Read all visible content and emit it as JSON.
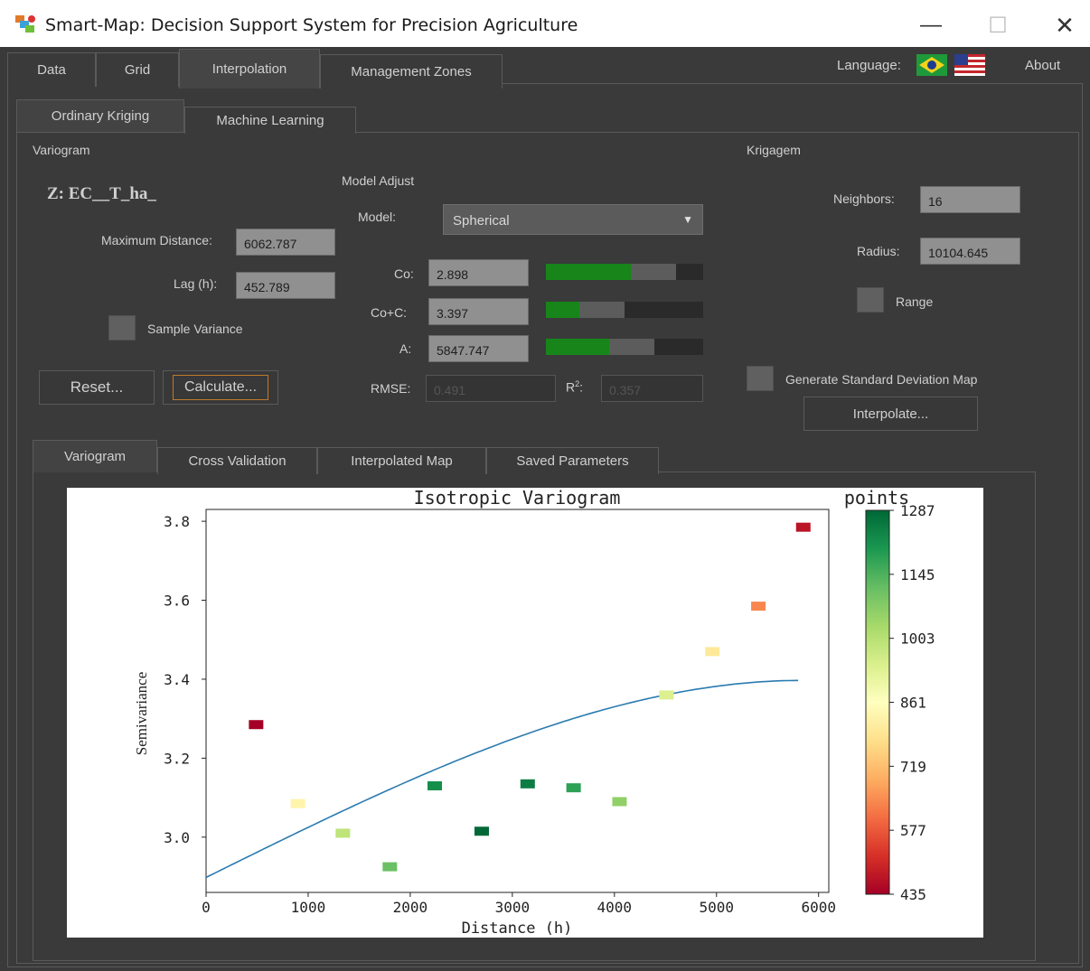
{
  "window": {
    "title": "Smart-Map: Decision Support System for Precision Agriculture",
    "minimize_glyph": "—",
    "maximize_glyph": "☐",
    "close_glyph": "✕"
  },
  "top_tabs": [
    "Data",
    "Grid",
    "Interpolation",
    "Management Zones"
  ],
  "language_label": "Language:",
  "about_label": "About",
  "sub_tabs": [
    "Ordinary Kriging",
    "Machine Learning"
  ],
  "variogram_section": {
    "heading": "Variogram",
    "z_label": "Z: EC__T_ha_",
    "max_distance_label": "Maximum Distance:",
    "max_distance_value": "6062.787",
    "lag_label": "Lag (h):",
    "lag_value": "452.789",
    "sample_variance_label": "Sample Variance",
    "reset_label": "Reset...",
    "calculate_label": "Calculate..."
  },
  "model_adjust": {
    "heading": "Model Adjust",
    "model_label": "Model:",
    "model_value": "Spherical",
    "co_label": "Co:",
    "co_value": "2.898",
    "coc_label": "Co+C:",
    "coc_value": "3.397",
    "a_label": "A:",
    "a_value": "5847.747",
    "rmse_label": "RMSE:",
    "rmse_value": "0.491",
    "r2_label": "R",
    "r2_sup": "2",
    "r2_colon": ":",
    "r2_value": "0.357",
    "sliders": [
      {
        "fill": 0.54,
        "mid": 0.83
      },
      {
        "fill": 0.21,
        "mid": 0.5
      },
      {
        "fill": 0.4,
        "mid": 0.69
      }
    ]
  },
  "krigagem": {
    "heading": "Krigagem",
    "neighbors_label": "Neighbors:",
    "neighbors_value": "16",
    "radius_label": "Radius:",
    "radius_value": "10104.645",
    "range_label": "Range",
    "std_map_label": "Generate Standard Deviation Map",
    "interpolate_label": "Interpolate..."
  },
  "bottom_tabs": [
    "Variogram",
    "Cross Validation",
    "Interpolated Map",
    "Saved Parameters"
  ],
  "colors": {
    "bg": "#3a3a3a",
    "accent_green": "#17851a",
    "field_bg": "#909090",
    "line_blue": "#2b7bb0"
  },
  "chart_data": {
    "type": "scatter",
    "title": "Isotropic Variogram",
    "xlabel": "Distance (h)",
    "ylabel": "Semivariance",
    "xlim": [
      0,
      6100
    ],
    "ylim": [
      2.86,
      3.83
    ],
    "x_ticks": [
      0,
      1000,
      2000,
      3000,
      4000,
      5000,
      6000
    ],
    "y_ticks": [
      3.0,
      3.2,
      3.4,
      3.6,
      3.8
    ],
    "y_tick_labels": [
      "3.0",
      "3.2",
      "3.4",
      "3.6",
      "3.8"
    ],
    "grid": false,
    "points": [
      {
        "x": 490,
        "y": 3.285,
        "c": 435
      },
      {
        "x": 900,
        "y": 3.085,
        "c": 830
      },
      {
        "x": 1340,
        "y": 3.01,
        "c": 990
      },
      {
        "x": 1800,
        "y": 2.925,
        "c": 1110
      },
      {
        "x": 2240,
        "y": 3.13,
        "c": 1220
      },
      {
        "x": 2700,
        "y": 3.015,
        "c": 1287
      },
      {
        "x": 3150,
        "y": 3.135,
        "c": 1250
      },
      {
        "x": 3600,
        "y": 3.125,
        "c": 1180
      },
      {
        "x": 4050,
        "y": 3.09,
        "c": 1060
      },
      {
        "x": 4510,
        "y": 3.36,
        "c": 940
      },
      {
        "x": 4960,
        "y": 3.47,
        "c": 800
      },
      {
        "x": 5410,
        "y": 3.585,
        "c": 640
      },
      {
        "x": 5850,
        "y": 3.785,
        "c": 470
      }
    ],
    "model_curve": {
      "type": "spherical",
      "nugget": 2.898,
      "sill": 3.397,
      "range": 5847.747
    },
    "colorbar": {
      "label": "points",
      "min": 435,
      "max": 1287,
      "ticks": [
        "1287",
        "1145",
        "1003",
        "861",
        "719",
        "577",
        "435"
      ]
    }
  }
}
